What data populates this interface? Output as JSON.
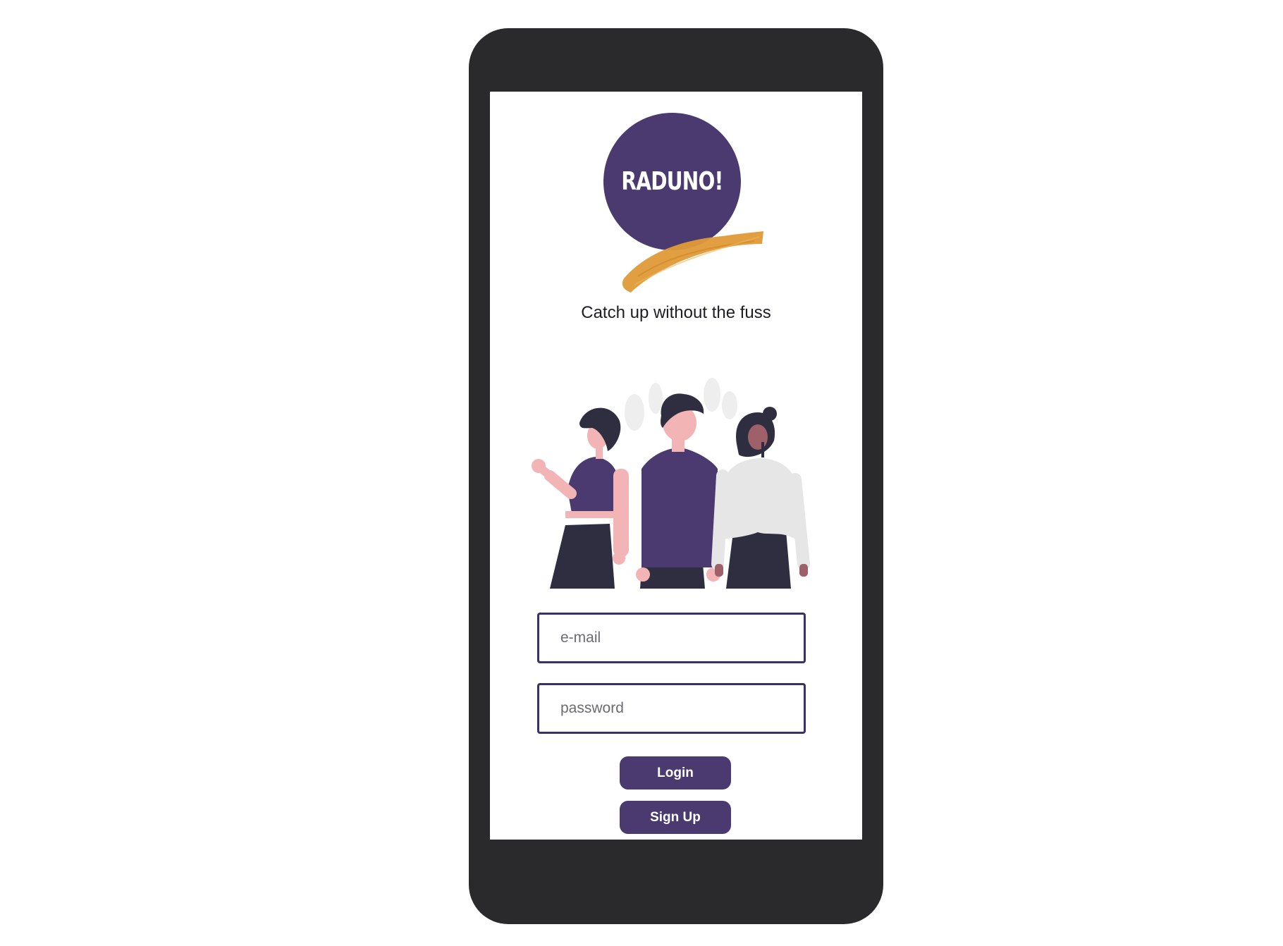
{
  "app": {
    "logo_text": "RADUNO!",
    "tagline": "Catch up without the fuss"
  },
  "form": {
    "email_placeholder": "e-mail",
    "email_value": "",
    "password_placeholder": "password",
    "password_value": "",
    "login_label": "Login",
    "signup_label": "Sign Up"
  },
  "colors": {
    "brand_purple": "#4a3a70",
    "accent_orange": "#e09a37",
    "phone_frame": "#2a292b",
    "field_border": "#3b3166"
  },
  "icons": {
    "illustration": "group-of-people-illustration",
    "logo": "raduno-logo"
  }
}
